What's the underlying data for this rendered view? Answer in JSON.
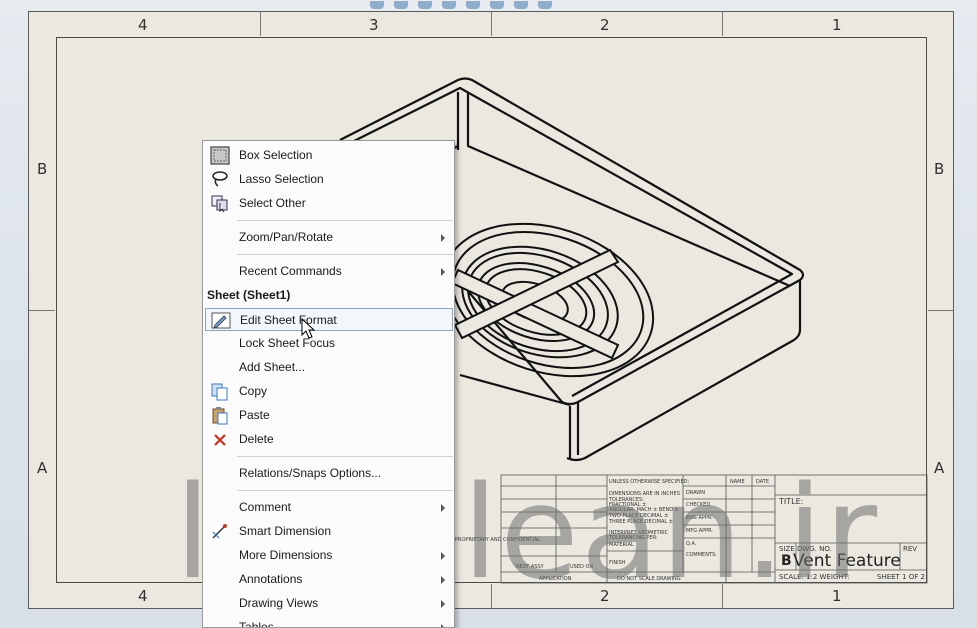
{
  "drawing": {
    "column_labels_top": [
      "4",
      "3",
      "2",
      "1"
    ],
    "column_labels_bottom": [
      "4",
      "2",
      "1"
    ],
    "row_labels_left": [
      "B",
      "A"
    ],
    "row_labels_right": [
      "B",
      "A"
    ]
  },
  "title_block": {
    "title": "Vent Feature",
    "size": "B",
    "dwg_no_label": "SIZE  DWG. NO.",
    "rev_label": "REV",
    "scale": "SCALE: 1:2  WEIGHT:",
    "sheet": "SHEET 1 OF 2",
    "title_label": "TITLE:",
    "name_label": "NAME",
    "date_label": "DATE",
    "drawn_label": "DRAWN",
    "checked_label": "CHECKED",
    "eng_appr_label": "ENG APPR.",
    "mfg_appr_label": "MFG APPR.",
    "qa_label": "Q.A.",
    "comments_label": "COMMENTS:",
    "next_assy_label": "NEXT ASSY",
    "used_on_label": "USED ON",
    "application_label": "APPLICATION",
    "do_not_scale": "DO NOT SCALE DRAWING",
    "finish_label": "FINISH",
    "material_label": "MATERIAL",
    "proprietary": "PROPRIETARY AND CONFIDENTIAL",
    "unless_specified": "UNLESS OTHERWISE SPECIFIED:",
    "dimensions_note": "DIMENSIONS ARE IN INCHES",
    "tolerances": "TOLERANCES:",
    "fractional": "FRACTIONAL ±",
    "angular": "ANGULAR: MACH ±  BEND ±",
    "two_place": "TWO PLACE DECIMAL  ±",
    "three_place": "THREE PLACE DECIMAL ±",
    "interpret": "INTERPRET GEOMETRIC",
    "tolerancing": "TOLERANCING PER:"
  },
  "watermark": "lets-lean.ir",
  "context_menu": {
    "items": [
      {
        "label": "Box Selection",
        "icon": "box-selection-icon",
        "submenu": false
      },
      {
        "label": "Lasso Selection",
        "icon": "lasso-selection-icon",
        "submenu": false
      },
      {
        "label": "Select Other",
        "icon": "select-other-icon",
        "submenu": false
      },
      {
        "label": "Zoom/Pan/Rotate",
        "icon": "",
        "submenu": true
      },
      {
        "label": "Recent Commands",
        "icon": "",
        "submenu": true
      },
      {
        "label": "Edit Sheet Format",
        "icon": "edit-sheet-format-icon",
        "submenu": false
      },
      {
        "label": "Lock Sheet Focus",
        "icon": "",
        "submenu": false
      },
      {
        "label": "Add Sheet...",
        "icon": "",
        "submenu": false
      },
      {
        "label": "Copy",
        "icon": "copy-icon",
        "submenu": false
      },
      {
        "label": "Paste",
        "icon": "paste-icon",
        "submenu": false
      },
      {
        "label": "Delete",
        "icon": "delete-icon",
        "submenu": false
      },
      {
        "label": "Relations/Snaps Options...",
        "icon": "",
        "submenu": false
      },
      {
        "label": "Comment",
        "icon": "",
        "submenu": true
      },
      {
        "label": "Smart Dimension",
        "icon": "smart-dimension-icon",
        "submenu": false
      },
      {
        "label": "More Dimensions",
        "icon": "",
        "submenu": true
      },
      {
        "label": "Annotations",
        "icon": "",
        "submenu": true
      },
      {
        "label": "Drawing Views",
        "icon": "",
        "submenu": true
      },
      {
        "label": "Tables",
        "icon": "",
        "submenu": true
      }
    ],
    "section_header": "Sheet (Sheet1)"
  },
  "colors": {
    "sheet_background": "#eae8df",
    "menu_background": "#fbfbfb",
    "highlight_border": "#8aa4c4",
    "delete_icon": "#d03020",
    "copy_icon": "#3a78c8"
  }
}
